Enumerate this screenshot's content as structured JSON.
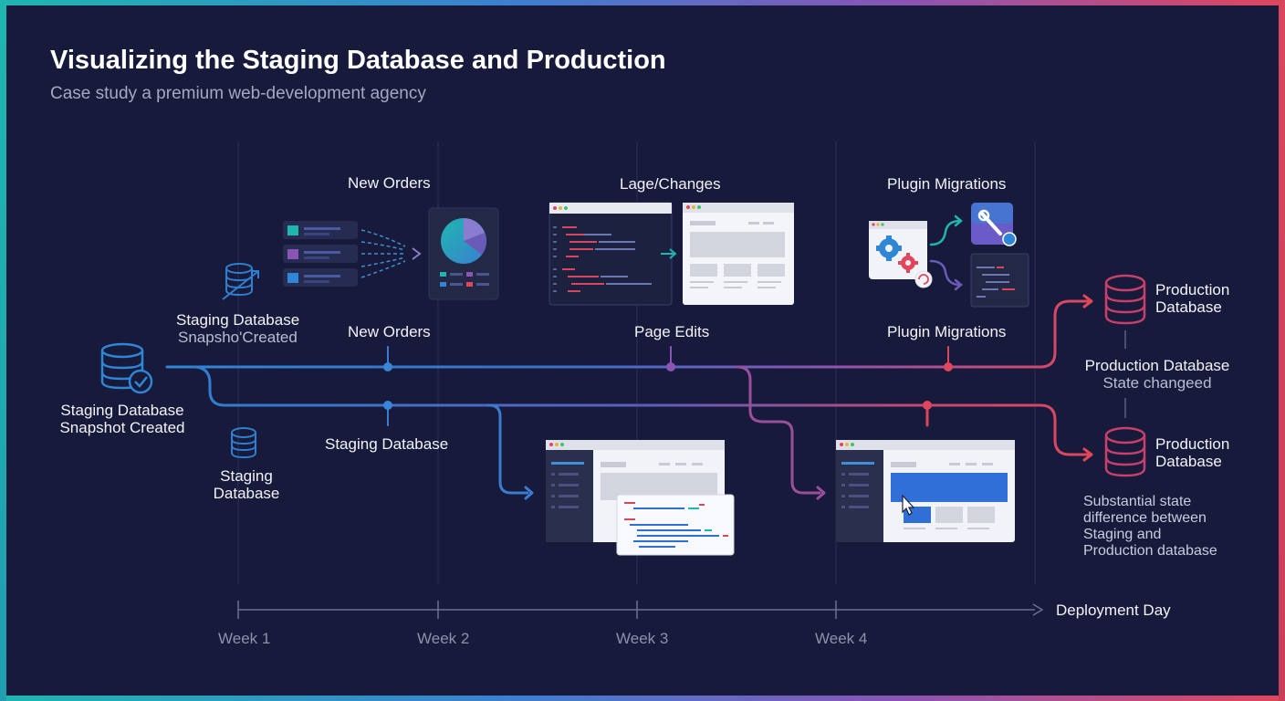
{
  "header": {
    "title": "Visualizing the Staging Database and Production",
    "subtitle": "Case study a premium web-development agency"
  },
  "top_labels": {
    "new_orders": "New Orders",
    "page_changes": "Lage/Changes",
    "plugin_migrations": "Plugin Migrations"
  },
  "line_labels": {
    "new_orders": "New Orders",
    "page_edits": "Page Edits",
    "plugin_migrations": "Plugin Migrations",
    "staging_database": "Staging Database"
  },
  "left": {
    "snapshot_small_title": "Staging Database",
    "snapshot_small_sub": "Snapsho'Created",
    "snapshot_main_line1": "Staging Database",
    "snapshot_main_line2": "Snapshot Created",
    "staging_line1": "Staging",
    "staging_line2": "Database"
  },
  "right": {
    "prod_top_line1": "Production",
    "prod_top_line2": "Database",
    "prod_state_title": "Production Database",
    "prod_state_sub": "State changeed",
    "prod_bottom_line1": "Production",
    "prod_bottom_line2": "Database",
    "difference_note": "Substantial state difference between Staging and Production database"
  },
  "timeline": {
    "weeks": [
      "Week 1",
      "Week 2",
      "Week 3",
      "Week 4"
    ],
    "end_label": "Deployment Day"
  },
  "colors": {
    "background": "#171a3a",
    "staging_blue": "#2f7fd0",
    "teal": "#1fb6b0",
    "purple": "#8a55b5",
    "production_red": "#e0465c"
  },
  "icons": [
    "database-icon",
    "database-check-icon",
    "pie-chart-icon",
    "code-editor-icon",
    "browser-window-icon",
    "gear-icon",
    "wrench-icon",
    "cursor-icon"
  ]
}
